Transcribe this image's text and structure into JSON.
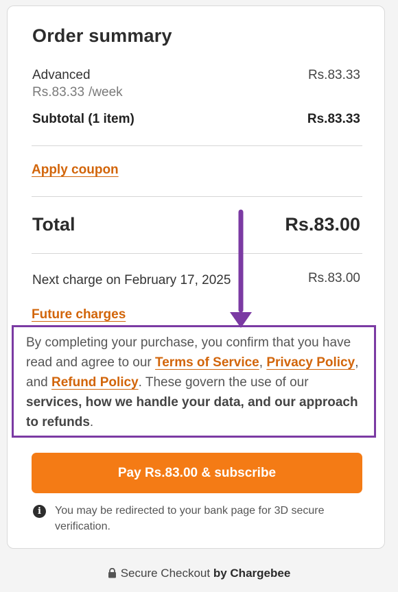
{
  "summary": {
    "title": "Order summary",
    "item": {
      "name": "Advanced",
      "price": "Rs.83.33",
      "unit_price": "Rs.83.33",
      "period": "/week"
    },
    "subtotal_label": "Subtotal (1 item)",
    "subtotal_value": "Rs.83.33",
    "coupon_link": "Apply coupon",
    "total_label": "Total",
    "total_value": "Rs.83.00",
    "next_charge_label": "Next charge on February 17, 2025",
    "next_charge_value": "Rs.83.00",
    "future_charges_link": "Future charges"
  },
  "terms": {
    "part1": "By completing your purchase, you confirm that you have read and agree to our ",
    "terms_link": "Terms of Service",
    "sep1": ",",
    "privacy_link": "Privacy Policy",
    "sep2": ", and ",
    "refund_link": "Refund Policy",
    "part2": ". These govern the use of our ",
    "bold_part": "services, how we handle your data, and our approach to refunds",
    "end": "."
  },
  "pay_button": "Pay Rs.83.00 & subscribe",
  "info_text": "You may be redirected to your bank page for 3D secure verification.",
  "footer": {
    "prefix": "Secure Checkout",
    "brand": "by Chargebee"
  },
  "colors": {
    "accent": "#f47b15",
    "link": "#d2650a",
    "annotation": "#7b3aa3"
  },
  "icons": [
    "info-icon",
    "lock-icon",
    "annotation-arrow"
  ]
}
